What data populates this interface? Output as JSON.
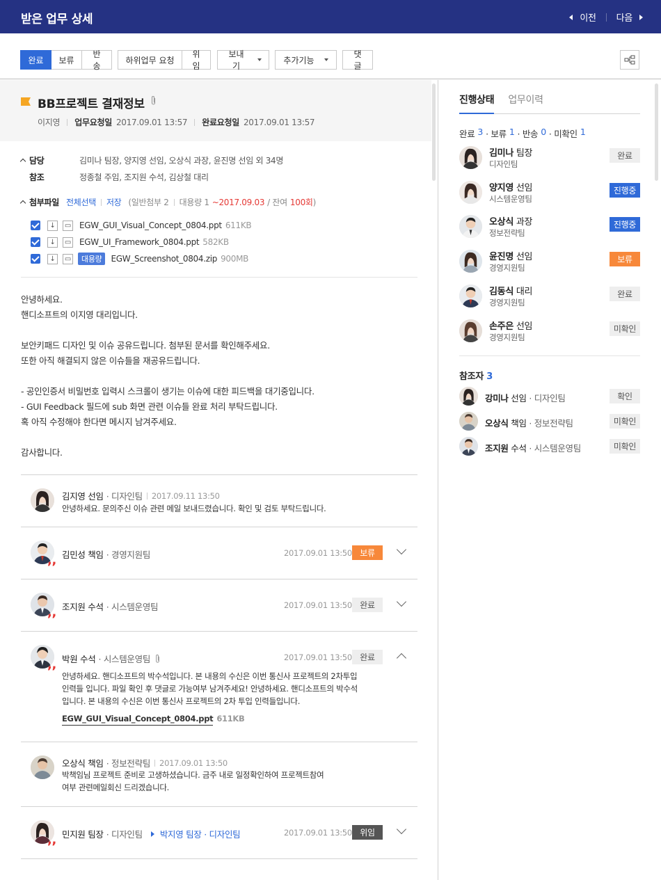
{
  "header": {
    "title": "받은 업무 상세",
    "prev": "이전",
    "next": "다음"
  },
  "toolbar": {
    "group1": [
      "완료",
      "보류",
      "반송"
    ],
    "group2": [
      "하위업무 요청",
      "위임"
    ],
    "send": "보내기",
    "more": "추가기능",
    "comment": "댓글",
    "share_icon": "share-icon"
  },
  "doc": {
    "title": "BB프로젝트 결재정보",
    "author": "이지영",
    "req_label": "업무요청일",
    "req_date": "2017.09.01  13:57",
    "done_label": "완료요청일",
    "done_date": "2017.09.01  13:57"
  },
  "assign": {
    "label": "담당",
    "value": "김미나 팀장, 양지영 선임, 오상식 과장, 윤진명 선임 외 34명",
    "ref_label": "참조",
    "ref_value": "정종철 주임, 조지원 수석, 김상철 대리"
  },
  "attach": {
    "label": "첨부파일",
    "select_all": "전체선택",
    "save": "저장",
    "info_prefix": "(일반첨부 2",
    "big_label": "대용량 1",
    "big_date": "~2017.09.03",
    "remain_label": "/ 잔여",
    "remain": "100회",
    "close": ")",
    "files": [
      {
        "name": "EGW_GUI_Visual_Concept_0804.ppt",
        "size": "611KB",
        "tag": ""
      },
      {
        "name": "EGW_UI_Framework_0804.ppt",
        "size": "582KB",
        "tag": ""
      },
      {
        "name": "EGW_Screenshot_0804.zip",
        "size": "900MB",
        "tag": "대용량"
      }
    ]
  },
  "body": "안녕하세요.\n핸디소프트의 이지영 대리입니다.\n\n보안키패드 디자인 및 이슈 공유드립니다. 첨부된 문서를 확인해주세요.\n또한 아직 해결되지 않은 이슈들을 재공유드립니다.\n\n- 공인인증서 비밀번호 입력시 스크롤이 생기는 이슈에 대한 피드백을 대기중입니다.\n- GUI Feedback 필드에 sub 화면 관련 이슈들 완료 처리 부탁드립니다.\n혹 아직 수정해야 한다면 메시지 남겨주세요.\n\n감사합니다.",
  "comments": [
    {
      "name": "김지영 선임",
      "dept": "· 디자인팀",
      "date": "2017.09.11  13:50",
      "text": "안녕하세요. 문의주신 이슈 관련 메일 보내드렸습니다. 확인 및 검토 부탁드립니다."
    },
    {
      "name": "김민성 책임",
      "dept": "· 경영지원팀",
      "date": "2017.09.01  13:50",
      "badge": "보류"
    },
    {
      "name": "조지원 수석",
      "dept": "· 시스템운영팀",
      "date": "2017.09.01  13:50",
      "badge": "완료"
    },
    {
      "name": "박원 수석",
      "dept": "· 시스템운영팀",
      "date": "2017.09.01  13:50",
      "badge": "완료",
      "text1": "안녕하세요. 핸디소프트의 박수석입니다. 본 내용의 수신은 이번 통신사 프로젝트의 2차투입",
      "text2": "인력들 입니다. 파일 확인 후 댓글로 가능여부 남겨주세요! 안녕하세요. 핸디소프트의 박수석",
      "text3": "입니다. 본 내용의 수신은 이번 통신사 프로젝트의 2차 투입 인력들입니다.",
      "file": "EGW_GUI_Visual_Concept_0804.ppt",
      "file_size": "611KB"
    },
    {
      "name": "오상식 책임",
      "dept": "· 정보전략팀",
      "date": "2017.09.01  13:50",
      "text1": "박책임님 프로젝트 준비로 고생하셨습니다. 금주 내로 일정확인하여 프로젝트참여",
      "text2": "여부 관련메일회신 드리겠습니다."
    },
    {
      "name": "민지원 팀장",
      "dept": "· 디자인팀",
      "to": "박지영 팀장 · 디자인팀",
      "date": "2017.09.01  13:50",
      "badge": "위임"
    }
  ],
  "side": {
    "tab_active": "진행상태",
    "tab_other": "업무이력",
    "summary": [
      {
        "label": "완료",
        "n": "3"
      },
      {
        "label": "· 보류",
        "n": "1"
      },
      {
        "label": "· 반송",
        "n": "0"
      },
      {
        "label": "· 미확인",
        "n": "1"
      }
    ],
    "people": [
      {
        "name": "김미나",
        "rank": "팀장",
        "dept": "디자인팀",
        "status": "완료"
      },
      {
        "name": "양지영",
        "rank": "선임",
        "dept": "시스템운영팀",
        "status": "진행중"
      },
      {
        "name": "오상식",
        "rank": "과장",
        "dept": "정보전략팀",
        "status": "진행중"
      },
      {
        "name": "윤진명",
        "rank": "선임",
        "dept": "경영지원팀",
        "status": "보류"
      },
      {
        "name": "김동식",
        "rank": "대리",
        "dept": "경영지원팀",
        "status": "완료"
      },
      {
        "name": "손주은",
        "rank": "선임",
        "dept": "경영지원팀",
        "status": "미확인"
      }
    ],
    "ref_label": "참조자",
    "ref_count": "3",
    "refs": [
      {
        "name": "강미나",
        "rank": "선임",
        "dept": "· 디자인팀",
        "status": "확인"
      },
      {
        "name": "오상식",
        "rank": "책임",
        "dept": "· 정보전략팀",
        "status": "미확인"
      },
      {
        "name": "조지원",
        "rank": "수석",
        "dept": "· 시스템운영팀",
        "status": "미확인"
      }
    ]
  },
  "colors": {
    "header": "#253283",
    "primary": "#2f6ad8",
    "hold": "#f7883a",
    "alert": "#e53935"
  }
}
